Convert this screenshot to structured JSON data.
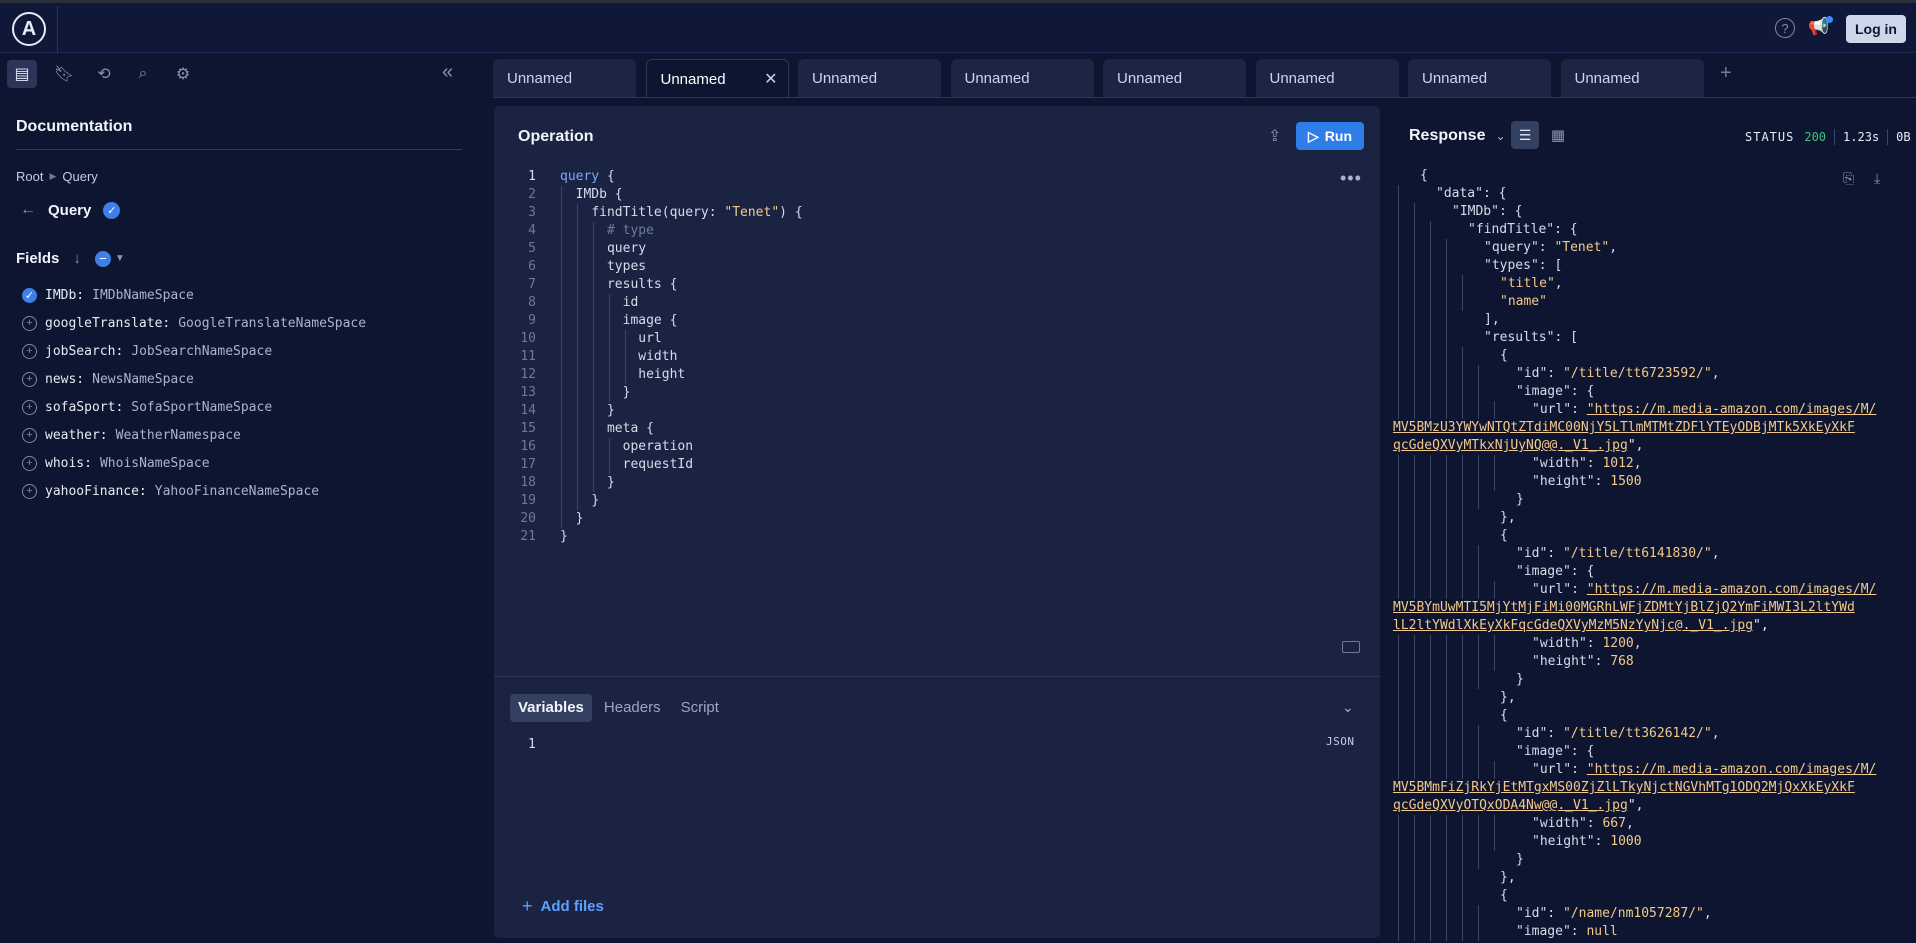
{
  "header": {
    "logo_letter": "A",
    "help_icon": "help-icon",
    "announce_icon": "megaphone-icon",
    "login_label": "Log in"
  },
  "left": {
    "doc_title": "Documentation",
    "breadcrumb": [
      "Root",
      "Query"
    ],
    "query_title": "Query",
    "fields_title": "Fields",
    "fields": [
      {
        "name": "IMDb:",
        "type": "IMDbNameSpace",
        "checked": true
      },
      {
        "name": "googleTranslate:",
        "type": "GoogleTranslateNameSpace",
        "checked": false
      },
      {
        "name": "jobSearch:",
        "type": "JobSearchNameSpace",
        "checked": false
      },
      {
        "name": "news:",
        "type": "NewsNameSpace",
        "checked": false
      },
      {
        "name": "sofaSport:",
        "type": "SofaSportNameSpace",
        "checked": false
      },
      {
        "name": "weather:",
        "type": "WeatherNamespace",
        "checked": false
      },
      {
        "name": "whois:",
        "type": "WhoisNameSpace",
        "checked": false
      },
      {
        "name": "yahooFinance:",
        "type": "YahooFinanceNameSpace",
        "checked": false
      }
    ]
  },
  "tabs": [
    "Unnamed",
    "Unnamed",
    "Unnamed",
    "Unnamed",
    "Unnamed",
    "Unnamed",
    "Unnamed",
    "Unnamed"
  ],
  "active_tab": 1,
  "operation": {
    "title": "Operation",
    "run_label": "Run",
    "lines": [
      "query {",
      "  IMDb {",
      "    findTitle(query: \"Tenet\") {",
      "      # type",
      "      query",
      "      types",
      "      results {",
      "        id",
      "        image {",
      "          url",
      "          width",
      "          height",
      "        }",
      "      }",
      "      meta {",
      "        operation",
      "        requestId",
      "      }",
      "    }",
      "  }",
      "}"
    ]
  },
  "variables": {
    "tabs": [
      "Variables",
      "Headers",
      "Script"
    ],
    "active": 0,
    "format_label": "JSON",
    "line1": "1",
    "add_files_label": "Add files"
  },
  "response": {
    "title": "Response",
    "status_label": "STATUS",
    "status_code": "200",
    "time": "1.23s",
    "size": "0B",
    "lines": [
      {
        "d": 0,
        "t": "{"
      },
      {
        "d": 1,
        "t": "\"data\": {"
      },
      {
        "d": 2,
        "t": "\"IMDb\": {"
      },
      {
        "d": 3,
        "t": "\"findTitle\": {"
      },
      {
        "d": 4,
        "t": "\"query\": ",
        "v": "\"Tenet\"",
        "e": ","
      },
      {
        "d": 4,
        "t": "\"types\": ["
      },
      {
        "d": 5,
        "t": "",
        "v": "\"title\"",
        "e": ","
      },
      {
        "d": 5,
        "t": "",
        "v": "\"name\""
      },
      {
        "d": 4,
        "t": "],"
      },
      {
        "d": 4,
        "t": "\"results\": ["
      },
      {
        "d": 5,
        "t": "{"
      },
      {
        "d": 6,
        "t": "\"id\": ",
        "v": "\"/title/tt6723592/\"",
        "e": ","
      },
      {
        "d": 6,
        "t": "\"image\": {"
      },
      {
        "d": 7,
        "t": "\"url\": ",
        "u": "\"https://m.media-amazon.com/images/M/"
      },
      {
        "w": true,
        "u": "MV5BMzU3YWYwNTQtZTdiMC00NjY5LTlmMTMtZDFlYTEyODBjMTk5XkEyXkF"
      },
      {
        "w": true,
        "u": "qcGdeQXVyMTkxNjUyNQ@@._V1_.jpg",
        "e": "\","
      },
      {
        "d": 7,
        "t": "\"width\": ",
        "v": "1012",
        "e": ","
      },
      {
        "d": 7,
        "t": "\"height\": ",
        "v": "1500"
      },
      {
        "d": 6,
        "t": "}"
      },
      {
        "d": 5,
        "t": "},"
      },
      {
        "d": 5,
        "t": "{"
      },
      {
        "d": 6,
        "t": "\"id\": ",
        "v": "\"/title/tt6141830/\"",
        "e": ","
      },
      {
        "d": 6,
        "t": "\"image\": {"
      },
      {
        "d": 7,
        "t": "\"url\": ",
        "u": "\"https://m.media-amazon.com/images/M/"
      },
      {
        "w": true,
        "u": "MV5BYmUwMTI5MjYtMjFiMi00MGRhLWFjZDMtYjBlZjQ2YmFiMWI3L2ltYWd"
      },
      {
        "w": true,
        "u": "lL2ltYWdlXkEyXkFqcGdeQXVyMzM5NzYyNjc@._V1_.jpg",
        "e": "\","
      },
      {
        "d": 7,
        "t": "\"width\": ",
        "v": "1200",
        "e": ","
      },
      {
        "d": 7,
        "t": "\"height\": ",
        "v": "768"
      },
      {
        "d": 6,
        "t": "}"
      },
      {
        "d": 5,
        "t": "},"
      },
      {
        "d": 5,
        "t": "{"
      },
      {
        "d": 6,
        "t": "\"id\": ",
        "v": "\"/title/tt3626142/\"",
        "e": ","
      },
      {
        "d": 6,
        "t": "\"image\": {"
      },
      {
        "d": 7,
        "t": "\"url\": ",
        "u": "\"https://m.media-amazon.com/images/M/"
      },
      {
        "w": true,
        "u": "MV5BMmFiZjRkYjEtMTgxMS00ZjZlLTkyNjctNGVhMTg1ODQ2MjQxXkEyXkF"
      },
      {
        "w": true,
        "u": "qcGdeQXVyOTQxODA4Nw@@._V1_.jpg",
        "e": "\","
      },
      {
        "d": 7,
        "t": "\"width\": ",
        "v": "667",
        "e": ","
      },
      {
        "d": 7,
        "t": "\"height\": ",
        "v": "1000"
      },
      {
        "d": 6,
        "t": "}"
      },
      {
        "d": 5,
        "t": "},"
      },
      {
        "d": 5,
        "t": "{"
      },
      {
        "d": 6,
        "t": "\"id\": ",
        "v": "\"/name/nm1057287/\"",
        "e": ","
      },
      {
        "d": 6,
        "t": "\"image\": ",
        "v": "null"
      }
    ]
  }
}
